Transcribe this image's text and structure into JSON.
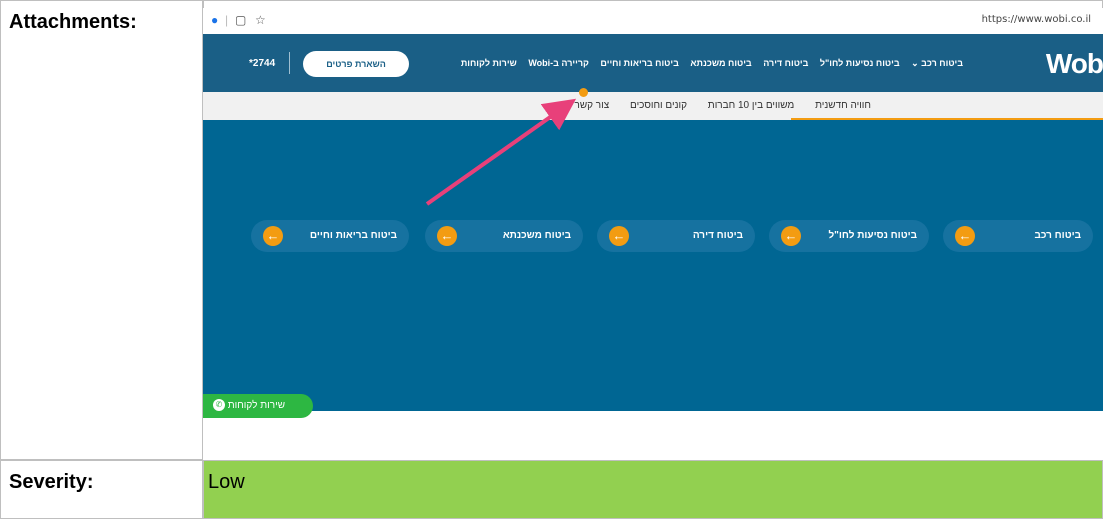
{
  "labels": {
    "attachments": "Attachments:",
    "severity": "Severity:"
  },
  "severity": {
    "value": "Low",
    "color": "#92d050"
  },
  "screenshot": {
    "browser": {
      "url": "https://www.wobi.co.il",
      "icons": [
        "profile-icon",
        "extension-icon",
        "star-icon",
        "settings-icon"
      ]
    },
    "nav": {
      "logo": "Wob",
      "links": [
        "ביטוח רכב ⌄",
        "ביטוח נסיעות לחו\"ל",
        "ביטוח דירה",
        "ביטוח משכנתא",
        "ביטוח בריאות וחיים",
        "קריירה ב-Wobi",
        "שירות לקוחות"
      ],
      "leave_details": "השארת פרטים",
      "phone": "*2744"
    },
    "subnav": {
      "links": [
        "חוויה חדשנית",
        "משווים בין 10 חברות",
        "קונים וחוסכים",
        "צור קשר"
      ]
    },
    "products": [
      {
        "label": "ביטוח רכב"
      },
      {
        "label": "ביטוח נסיעות לחו\"ל"
      },
      {
        "label": "ביטוח דירה"
      },
      {
        "label": "ביטוח משכנתא"
      },
      {
        "label": "ביטוח בריאות וחיים"
      }
    ],
    "whatsapp": "שירות לקוחות",
    "colors": {
      "brand_blue": "#006693",
      "accent_orange": "#f39c12",
      "annotation_arrow": "#e8407a",
      "whatsapp_green": "#2db742"
    }
  }
}
